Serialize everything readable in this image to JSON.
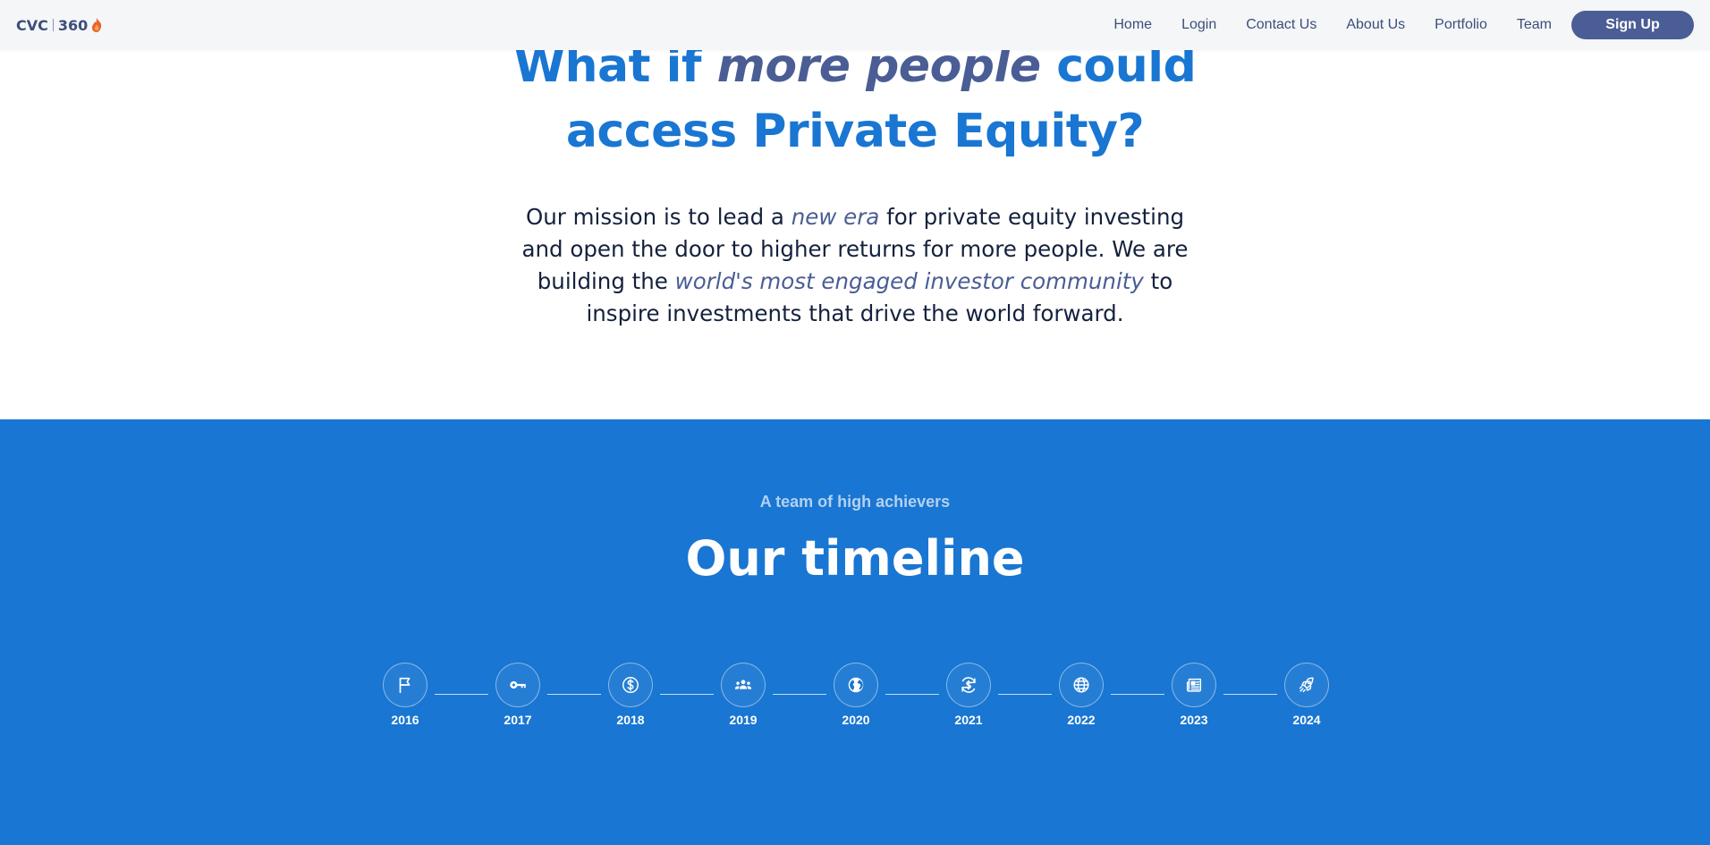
{
  "header": {
    "logo": {
      "left": "CVC",
      "right": "360"
    },
    "nav": [
      "Home",
      "Login",
      "Contact Us",
      "About Us",
      "Portfolio",
      "Team"
    ],
    "signup_label": "Sign Up"
  },
  "hero": {
    "headline_part1": "What if ",
    "headline_em": "more people",
    "headline_part2": " could",
    "headline_line2": "access Private Equity?",
    "mission_part1": "Our mission is to lead a ",
    "mission_em1": "new era",
    "mission_part2": " for private equity investing and open the door to higher returns for more people. We are building the ",
    "mission_em2": "world's most engaged investor community",
    "mission_part3": " to inspire investments that drive the world forward."
  },
  "timeline": {
    "eyebrow": "A team of high achievers",
    "title": "Our timeline",
    "steps": [
      {
        "year": "2016",
        "icon": "flag-icon"
      },
      {
        "year": "2017",
        "icon": "key-icon"
      },
      {
        "year": "2018",
        "icon": "dollar-icon"
      },
      {
        "year": "2019",
        "icon": "people-icon"
      },
      {
        "year": "2020",
        "icon": "globe-icon"
      },
      {
        "year": "2021",
        "icon": "dollar-sync-icon"
      },
      {
        "year": "2022",
        "icon": "world-icon"
      },
      {
        "year": "2023",
        "icon": "newspaper-icon"
      },
      {
        "year": "2024",
        "icon": "rocket-icon"
      }
    ]
  },
  "colors": {
    "brand_blue": "#1976d2",
    "navy": "#4a5d94",
    "text_dark": "#14213d",
    "header_bg": "#f5f6f8",
    "logo_flame": "#e8622c"
  }
}
